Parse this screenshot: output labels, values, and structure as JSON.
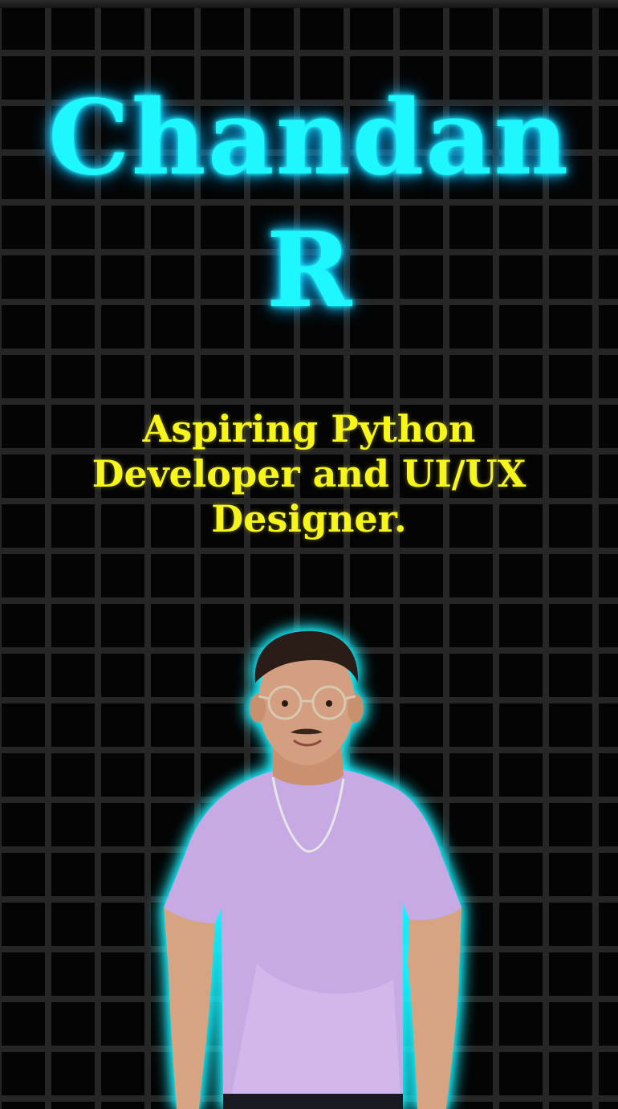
{
  "hero": {
    "name_line1": "Chandan",
    "name_line2": "R",
    "tagline": "Aspiring Python Developer and UI/UX Designer."
  },
  "colors": {
    "name_glow": "#1ff7ff",
    "tagline": "#f6f51c",
    "background": "#040404",
    "brick_mortar": "#262626",
    "portrait_outline_glow": "#19f3ff",
    "shirt": "#c7a9e4"
  },
  "portrait": {
    "icon": "person-portrait-icon"
  }
}
